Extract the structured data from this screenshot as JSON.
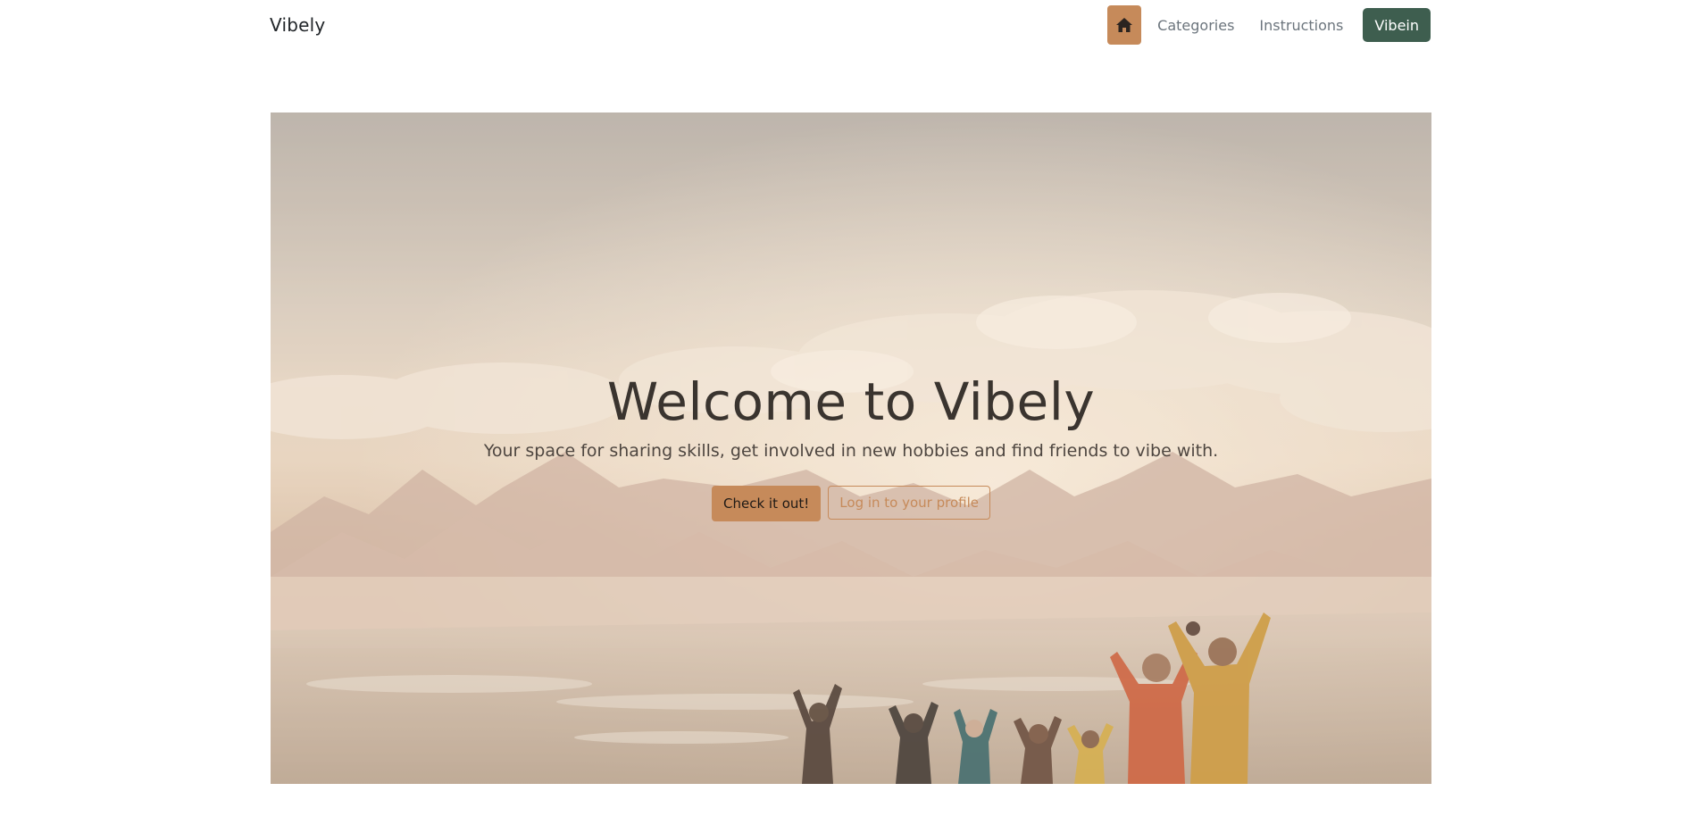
{
  "navbar": {
    "brand": "Vibely",
    "home_icon": "home-icon",
    "links": [
      {
        "label": "Categories"
      },
      {
        "label": "Instructions"
      }
    ],
    "cta_label": "Vibein"
  },
  "hero": {
    "title": "Welcome to Vibely",
    "subtitle": "Your space for sharing skills, get involved in new hobbies and find friends to vibe with.",
    "primary_button": "Check it out!",
    "secondary_button": "Log in to your profile"
  },
  "colors": {
    "accent": "#c68a5a",
    "cta_green": "#3e5e4f",
    "text_dark": "#3a342f"
  }
}
